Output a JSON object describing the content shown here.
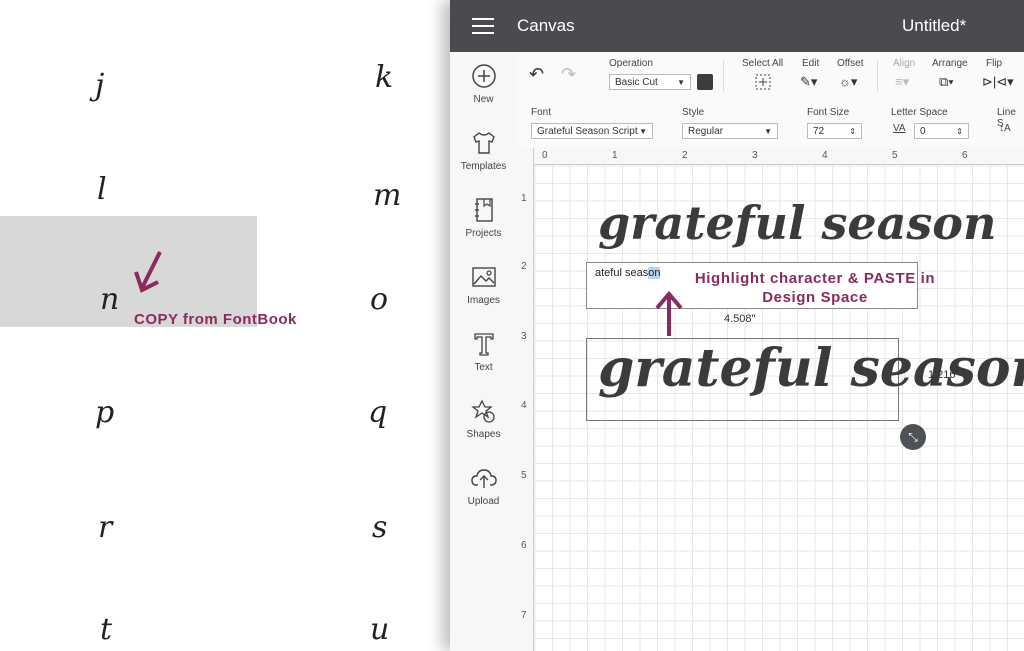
{
  "fontbook_glyphs": [
    "j",
    "k",
    "l",
    "m",
    "n",
    "o",
    "p",
    "q",
    "r",
    "s",
    "t",
    "u"
  ],
  "annotations": {
    "copy_label": "COPY from FontBook",
    "paste_label_line1": "Highlight character & PASTE in",
    "paste_label_line2": "Design Space",
    "accent_color": "#8a2a5e"
  },
  "titlebar": {
    "app_title": "Canvas",
    "doc_title": "Untitled*"
  },
  "sidebar": {
    "items": [
      {
        "label": "New",
        "icon": "plus-circle-icon"
      },
      {
        "label": "Templates",
        "icon": "tshirt-icon"
      },
      {
        "label": "Projects",
        "icon": "notebook-icon"
      },
      {
        "label": "Images",
        "icon": "image-icon"
      },
      {
        "label": "Text",
        "icon": "text-icon"
      },
      {
        "label": "Shapes",
        "icon": "shapes-icon"
      },
      {
        "label": "Upload",
        "icon": "cloud-upload-icon"
      }
    ]
  },
  "toolbar": {
    "operation_label": "Operation",
    "operation_value": "Basic Cut",
    "select_all": "Select All",
    "edit": "Edit",
    "offset": "Offset",
    "align": "Align",
    "arrange": "Arrange",
    "flip": "Flip"
  },
  "text_toolbar": {
    "font_label": "Font",
    "font_value": "Grateful Season Script",
    "style_label": "Style",
    "style_value": "Regular",
    "size_label": "Font Size",
    "size_value": "72",
    "letter_space_label": "Letter Space",
    "letter_space_icon": "VA",
    "letter_space_value": "0",
    "line_space_label": "Line S"
  },
  "rulers": {
    "top": [
      "0",
      "1",
      "2",
      "3",
      "4",
      "5",
      "6"
    ],
    "left": [
      "1",
      "2",
      "3",
      "4",
      "5",
      "6",
      "7"
    ]
  },
  "canvas": {
    "preview_text": "grateful season",
    "textbox_prefix": "ateful seas",
    "textbox_selected": "on",
    "design_text": "grateful season",
    "width_label": "4.508\"",
    "height_label": "1.216\""
  }
}
